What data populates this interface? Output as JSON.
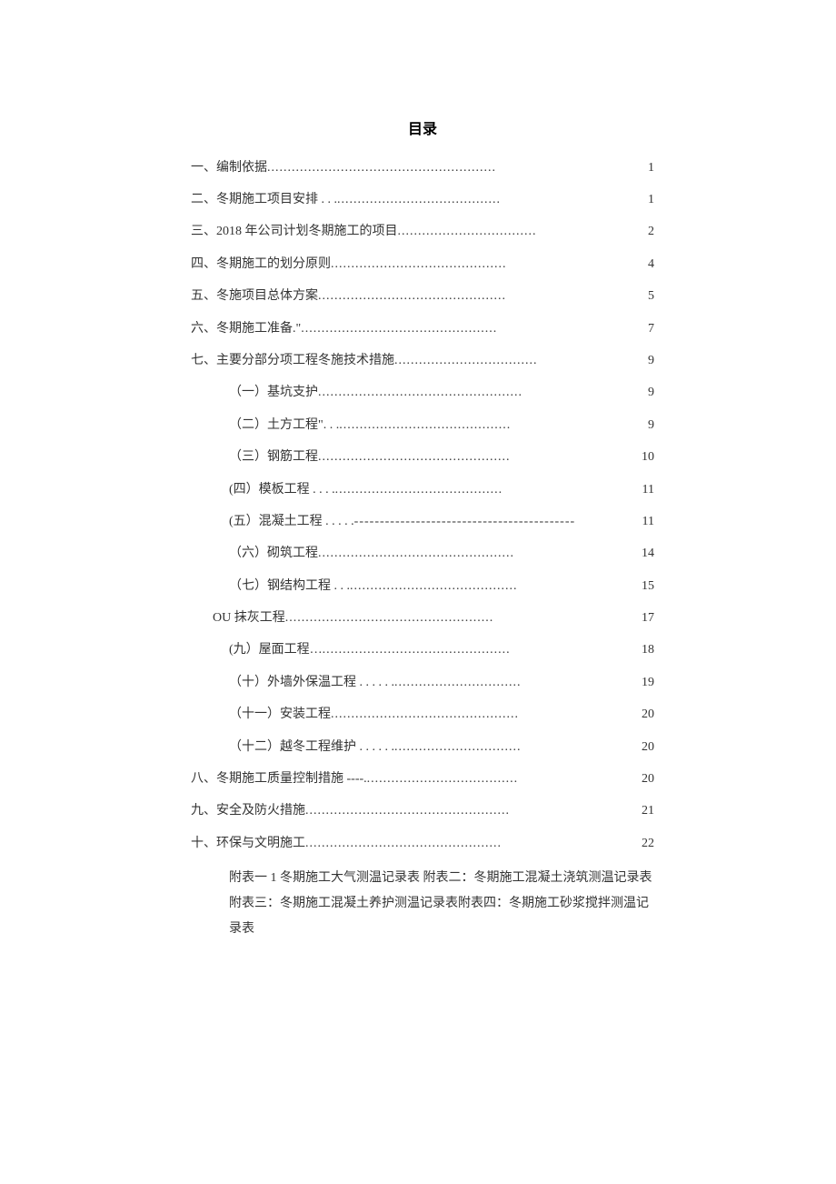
{
  "title": "目录",
  "entries": [
    {
      "num": "一、",
      "label": "编制依据 ",
      "dots": "........................................................",
      "page": "1",
      "indent": false
    },
    {
      "num": "二、",
      "label": "冬期施工项目安排 . . . ",
      "dots": "........................................",
      "page": "1",
      "indent": false
    },
    {
      "num": "三、",
      "label": "2018 年公司计划冬期施工的项目 ",
      "dots": "..................................",
      "page": "2",
      "indent": false
    },
    {
      "num": "四、",
      "label": "冬期施工的划分原则",
      "dots": "...........................................",
      "page": "4",
      "indent": false
    },
    {
      "num": "五、",
      "label": "冬施项目总体方案 ",
      "dots": "..............................................",
      "page": "5",
      "indent": false
    },
    {
      "num": "六、",
      "label": "冬期施工准备.\"",
      "dots": "................................................",
      "page": "7",
      "indent": false
    },
    {
      "num": "七、",
      "label": "主要分部分项工程冬施技术措施 ",
      "dots": "...................................",
      "page": "9",
      "indent": false
    },
    {
      "num": "",
      "label": "（一）基坑支护",
      "dots": "..................................................",
      "page": "9",
      "indent": true
    },
    {
      "num": "",
      "label": "（二）土方工程\". . . ",
      "dots": "..........................................",
      "page": "9",
      "indent": true
    },
    {
      "num": "",
      "label": "（三）钢筋工程 ",
      "dots": "...............................................",
      "page": "10",
      "indent": true
    },
    {
      "num": "",
      "label": "(四）模板工程 . . . . ",
      "dots": ".........................................",
      "page": "11",
      "indent": true
    },
    {
      "num": "",
      "label": "(五）混凝土工程 . . . . . ",
      "dots": "-------------------------------------------",
      "page": "11",
      "indent": true
    },
    {
      "num": "",
      "label": "（六）砌筑工程",
      "dots": "................................................",
      "page": "14",
      "indent": true
    },
    {
      "num": "",
      "label": "（七）钢结构工程 . . . ",
      "dots": ".........................................",
      "page": "15",
      "indent": true
    },
    {
      "num": "",
      "label": "OU 抹灰工程 ",
      "dots": "...................................................",
      "page": "17",
      "indent": true,
      "outdent": true
    },
    {
      "num": "",
      "label": "(九）屋面工程…",
      "dots": "..............................................",
      "page": "18",
      "indent": true
    },
    {
      "num": "",
      "label": "（十）外墙外保温工程 . . . . . . ",
      "dots": "...............................",
      "page": "19",
      "indent": true
    },
    {
      "num": "",
      "label": "（十一）安装工程",
      "dots": "..............................................",
      "page": "20",
      "indent": true
    },
    {
      "num": "",
      "label": "（十二）越冬工程维护 . . . . . . ",
      "dots": "...............................",
      "page": "20",
      "indent": true
    },
    {
      "num": "八、",
      "label": "冬期施工质量控制措施 ----.",
      "dots": ".....................................",
      "page": "20",
      "indent": false
    },
    {
      "num": "九、",
      "label": "安全及防火措施",
      "dots": "..................................................",
      "page": "21",
      "indent": false
    },
    {
      "num": "十、",
      "label": "环保与文明施工 ",
      "dots": "................................................",
      "page": "22",
      "indent": false
    }
  ],
  "appendix": "附表一 1 冬期施工大气测温记录表\n附表二：冬期施工混凝土浇筑测温记录表附表三：冬期施工混凝土养护测温记录表附表四：冬期施工砂浆搅拌测温记录表"
}
